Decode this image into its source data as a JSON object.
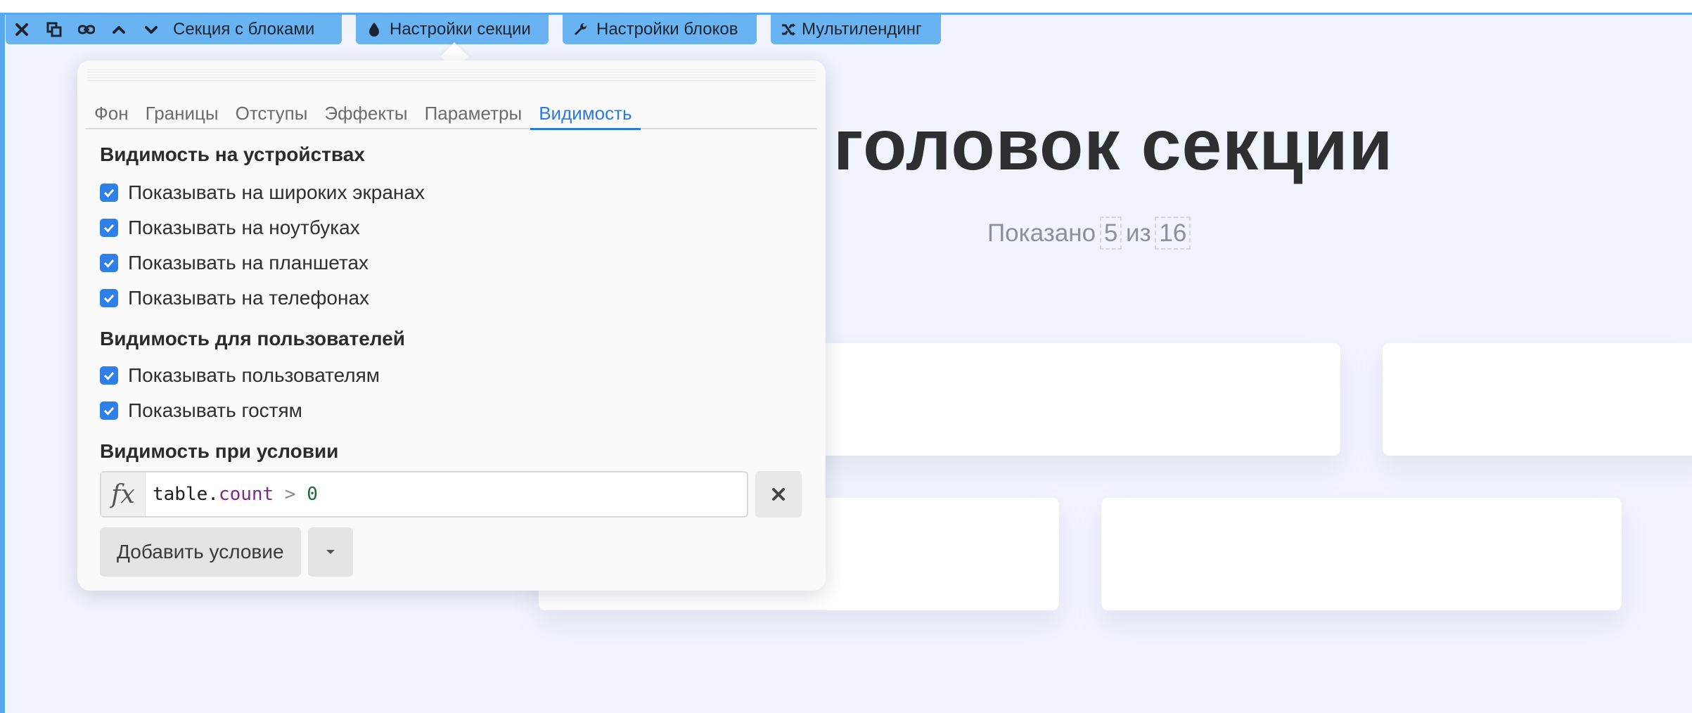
{
  "toolbar": {
    "section_label": "Секция с блоками",
    "section_settings_label": "Настройки секции",
    "block_settings_label": "Настройки блоков",
    "multilanding_label": "Мультилендинг"
  },
  "page": {
    "heading": "головок секции",
    "shown_prefix": "Показано",
    "shown_count": "5",
    "shown_of": "из",
    "shown_total": "16"
  },
  "popover": {
    "tabs": [
      {
        "label": "Фон"
      },
      {
        "label": "Границы"
      },
      {
        "label": "Отступы"
      },
      {
        "label": "Эффекты"
      },
      {
        "label": "Параметры"
      },
      {
        "label": "Видимость"
      }
    ],
    "active_tab": "Видимость",
    "devices": {
      "title": "Видимость на устройствах",
      "items": [
        {
          "label": "Показывать на широких экранах",
          "checked": true
        },
        {
          "label": "Показывать на ноутбуках",
          "checked": true
        },
        {
          "label": "Показывать на планшетах",
          "checked": true
        },
        {
          "label": "Показывать на телефонах",
          "checked": true
        }
      ]
    },
    "users": {
      "title": "Видимость для пользователей",
      "items": [
        {
          "label": "Показывать пользователям",
          "checked": true
        },
        {
          "label": "Показывать гостям",
          "checked": true
        }
      ]
    },
    "condition": {
      "title": "Видимость при условии",
      "fx_symbol": "fx",
      "code": {
        "object": "table",
        "dot": ".",
        "property": "count",
        "operator": ">",
        "value": "0"
      }
    },
    "add_condition_label": "Добавить условие"
  },
  "colors": {
    "toolbar_bg": "#69b3f3",
    "accent": "#2a7be3",
    "checkbox": "#2e80e8",
    "page_bg": "#f1f4fd"
  }
}
